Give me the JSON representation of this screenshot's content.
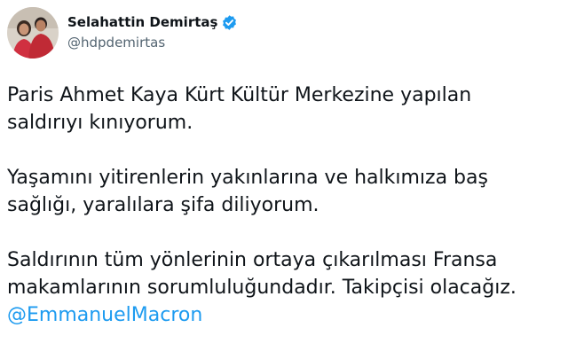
{
  "author": {
    "display_name": "Selahattin Demirtaş",
    "handle": "@hdpdemirtas",
    "verified": true,
    "verified_icon": "verified-badge-icon"
  },
  "tweet": {
    "paragraphs": [
      {
        "lines": [
          "Paris Ahmet Kaya Kürt Kültür Merkezine yapılan",
          "saldırıyı kınıyorum."
        ]
      },
      {
        "lines": [
          "Yaşamını yitirenlerin yakınlarına ve halkımıza baş",
          "sağlığı, yaralılara şifa diliyorum."
        ]
      },
      {
        "lines": [
          "Saldırının tüm yönlerinin ortaya çıkarılması Fransa",
          "makamlarının sorumluluğundadır. Takipçisi olacağız."
        ]
      }
    ],
    "mention": "@EmmanuelMacron"
  },
  "colors": {
    "text": "#0f1419",
    "secondary": "#536471",
    "link": "#1d9bf0",
    "verified": "#1d9bf0"
  }
}
